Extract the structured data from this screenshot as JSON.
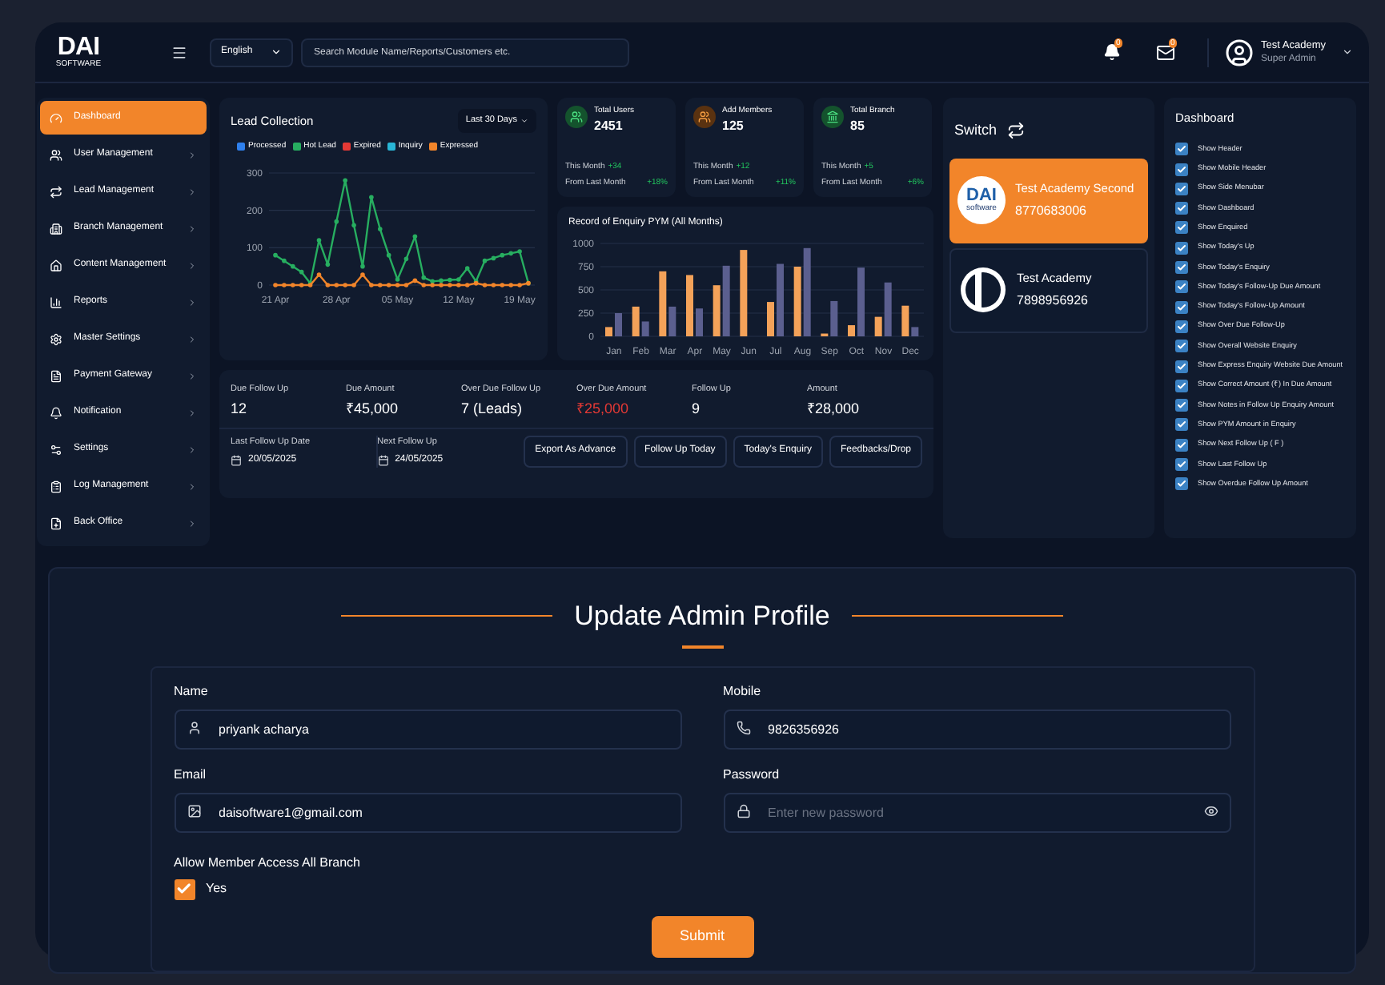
{
  "header": {
    "logo": "DAI",
    "logo_sub": "SOFTWARE",
    "language": "English",
    "search": {
      "placeholder": "Search Module Name/Reports/Customers etc."
    },
    "notifications": "0",
    "messages": "0",
    "user": {
      "name": "Test Academy",
      "role": "Super Admin"
    }
  },
  "sidebar": {
    "items": [
      {
        "label": "Dashboard",
        "selected": true
      },
      {
        "label": "User Management",
        "selected": false
      },
      {
        "label": "Lead Management",
        "selected": false
      },
      {
        "label": "Branch Management",
        "selected": false
      },
      {
        "label": "Content Management",
        "selected": false
      },
      {
        "label": "Reports",
        "selected": false
      },
      {
        "label": "Master Settings",
        "selected": false
      },
      {
        "label": "Payment Gateway",
        "selected": false
      },
      {
        "label": "Notification",
        "selected": false
      },
      {
        "label": "Settings",
        "selected": false
      },
      {
        "label": "Log Management",
        "selected": false
      },
      {
        "label": "Back Office",
        "selected": false
      }
    ]
  },
  "lead_collection": {
    "title": "Lead Collection",
    "range": "Last 30 Days",
    "chart_data": {
      "type": "line",
      "grid": true,
      "categories": [
        "21 Apr",
        null,
        null,
        null,
        null,
        null,
        null,
        "28 Apr",
        null,
        null,
        null,
        null,
        null,
        null,
        "05 May",
        null,
        null,
        null,
        null,
        null,
        null,
        "12 May",
        null,
        null,
        null,
        null,
        null,
        null,
        "19 May",
        null
      ],
      "yticks": [
        0,
        100,
        200,
        300
      ],
      "ylim": [
        0,
        300
      ],
      "series": [
        {
          "name": "Processed",
          "color": "#2f80ed",
          "values": [
            null,
            null,
            null,
            null,
            null,
            null,
            null,
            null,
            null,
            null,
            null,
            null,
            null,
            null,
            null,
            null,
            null,
            null,
            null,
            null,
            null,
            null,
            null,
            null,
            null,
            null,
            null,
            null,
            null,
            null
          ]
        },
        {
          "name": "Hot Lead",
          "color": "#27ae60",
          "values": [
            80,
            65,
            50,
            35,
            5,
            120,
            55,
            170,
            280,
            160,
            50,
            235,
            150,
            80,
            15,
            70,
            130,
            20,
            10,
            12,
            14,
            15,
            45,
            10,
            65,
            72,
            80,
            85,
            90,
            5
          ]
        },
        {
          "name": "Expired",
          "color": "#e53935",
          "values": [
            null,
            null,
            null,
            null,
            null,
            null,
            null,
            null,
            null,
            null,
            null,
            null,
            null,
            null,
            null,
            null,
            null,
            null,
            null,
            null,
            null,
            null,
            null,
            null,
            null,
            null,
            null,
            null,
            null,
            null
          ]
        },
        {
          "name": "Inquiry",
          "color": "#29b6d6",
          "values": [
            null,
            null,
            null,
            null,
            null,
            null,
            null,
            null,
            null,
            null,
            null,
            null,
            null,
            null,
            null,
            null,
            null,
            null,
            null,
            null,
            null,
            null,
            null,
            null,
            null,
            null,
            null,
            null,
            null,
            null
          ]
        },
        {
          "name": "Expressed",
          "color": "#f2852a",
          "values": [
            0,
            0,
            0,
            0,
            0,
            28,
            0,
            0,
            0,
            0,
            28,
            0,
            0,
            0,
            0,
            0,
            12,
            0,
            0,
            0,
            0,
            0,
            0,
            5,
            0,
            0,
            0,
            0,
            0,
            5
          ]
        }
      ]
    }
  },
  "stats": [
    {
      "title": "Total Users",
      "value": "2451",
      "month_label": "This Month",
      "month_value": "+34",
      "from_label": "From Last Month",
      "from_value": "+18%",
      "kind": "users"
    },
    {
      "title": "Add Members",
      "value": "125",
      "month_label": "This Month",
      "month_value": "+12",
      "from_label": "From Last Month",
      "from_value": "+11%",
      "kind": "members"
    },
    {
      "title": "Total Branch",
      "value": "85",
      "month_label": "This Month",
      "month_value": "+5",
      "from_label": "From Last Month",
      "from_value": "+6%",
      "kind": "branch"
    }
  ],
  "enquiry": {
    "title": "Record of Enquiry PYM (All Months)",
    "chart_data": {
      "type": "bar",
      "grid": true,
      "categories": [
        "Jan",
        "Feb",
        "Mar",
        "Apr",
        "May",
        "Jun",
        "Jul",
        "Aug",
        "Sep",
        "Oct",
        "Nov",
        "Dec"
      ],
      "yticks": [
        0,
        250,
        500,
        750,
        1000
      ],
      "ylim": [
        0,
        1000
      ],
      "series": [
        {
          "color": "#f4a259",
          "values": [
            100,
            320,
            700,
            660,
            550,
            930,
            370,
            750,
            30,
            120,
            210,
            330
          ]
        },
        {
          "color": "#5b5f8f",
          "values": [
            250,
            160,
            320,
            300,
            760,
            0,
            780,
            950,
            380,
            740,
            580,
            100
          ]
        }
      ]
    }
  },
  "followup": {
    "stats": [
      {
        "label": "Due Follow Up",
        "value": "12",
        "alert": false
      },
      {
        "label": "Due Amount",
        "value": "₹45,000",
        "alert": false
      },
      {
        "label": "Over Due Follow Up",
        "value": "7 (Leads)",
        "alert": false
      },
      {
        "label": "Over Due Amount",
        "value": "₹25,000",
        "alert": true
      },
      {
        "label": "Follow Up",
        "value": "9",
        "alert": false
      },
      {
        "label": "Amount",
        "value": "₹28,000",
        "alert": false
      }
    ],
    "dates": [
      {
        "label": "Last Follow Up Date",
        "value": "20/05/2025"
      },
      {
        "label": "Next Follow Up",
        "value": "24/05/2025"
      }
    ],
    "buttons": [
      "Export As Advance",
      "Follow Up Today",
      "Today's Enquiry",
      "Feedbacks/Drop"
    ]
  },
  "switch": {
    "title": "Switch",
    "accounts": [
      {
        "name": "Test Academy Second",
        "phone": "8770683006",
        "selected": true,
        "kind": "dai"
      },
      {
        "name": "Test Academy",
        "phone": "7898956926",
        "selected": false,
        "kind": "ring"
      }
    ],
    "logo_text": "DAI",
    "logo_sub": "software"
  },
  "dashboard_options": {
    "title": "Dashboard",
    "items": [
      {
        "label": "Show Header",
        "checked": true
      },
      {
        "label": "Show Mobile Header",
        "checked": true
      },
      {
        "label": "Show Side Menubar",
        "checked": true
      },
      {
        "label": "Show Dashboard",
        "checked": true
      },
      {
        "label": "Show Enquired",
        "checked": true
      },
      {
        "label": "Show Today's Up",
        "checked": true
      },
      {
        "label": "Show Today's Enquiry",
        "checked": true
      },
      {
        "label": "Show Today's Follow-Up Due Amount",
        "checked": true
      },
      {
        "label": "Show Today's Follow-Up Amount",
        "checked": true
      },
      {
        "label": "Show Over Due Follow-Up",
        "checked": true
      },
      {
        "label": "Show Overall Website Enquiry",
        "checked": true
      },
      {
        "label": "Show Express Enquiry Website Due Amount",
        "checked": true
      },
      {
        "label": "Show Correct Amount (₹) In Due Amount",
        "checked": true
      },
      {
        "label": "Show Notes in Follow Up Enquiry Amount",
        "checked": true
      },
      {
        "label": "Show PYM Amount in Enquiry",
        "checked": true
      },
      {
        "label": "Show Next Follow Up ( F )",
        "checked": true
      },
      {
        "label": "Show Last Follow Up",
        "checked": true
      },
      {
        "label": "Show Overdue Follow Up Amount",
        "checked": true
      }
    ]
  },
  "profile": {
    "title": "Update Admin Profile",
    "fields": [
      {
        "label": "Name",
        "value": "priyank acharya",
        "kind": "user"
      },
      {
        "label": "Mobile",
        "value": "9826356926",
        "kind": "phone"
      },
      {
        "label": "Email",
        "value": "daisoftware1@gmail.com",
        "kind": "email"
      },
      {
        "label": "Password",
        "placeholder": "Enter new password",
        "kind": "password"
      }
    ],
    "access": {
      "label": "Allow Member Access All Branch",
      "option": "Yes",
      "checked": true
    },
    "submit": "Submit"
  }
}
